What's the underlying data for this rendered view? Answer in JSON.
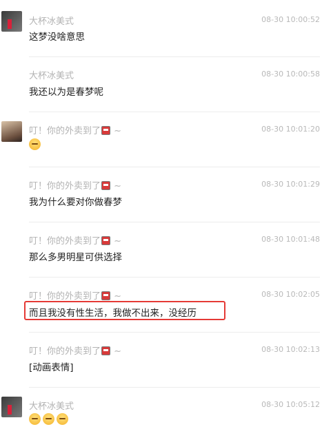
{
  "messages": [
    {
      "sender": "大杯冰美式",
      "time": "08-30 10:00:52",
      "text": "这梦没啥意思"
    },
    {
      "sender": "大杯冰美式",
      "time": "08-30 10:00:58",
      "text": "我还以为是春梦呢"
    },
    {
      "sender": "叮！你的外卖到了",
      "time": "08-30 10:01:20",
      "emoji": "😴"
    },
    {
      "sender": "叮！你的外卖到了",
      "time": "08-30 10:01:29",
      "text": "我为什么要对你做春梦"
    },
    {
      "sender": "叮！你的外卖到了",
      "time": "08-30 10:01:48",
      "text": "那么多男明星可供选择"
    },
    {
      "sender": "叮！你的外卖到了",
      "time": "08-30 10:02:05",
      "text": "而且我没有性生活，我做不出来，没经历"
    },
    {
      "sender": "叮！你的外卖到了",
      "time": "08-30 10:02:13",
      "text": "[动画表情]"
    },
    {
      "sender": "大杯冰美式",
      "time": "08-30 10:05:12",
      "emoji": "😌😌😌"
    }
  ],
  "name_suffix": "~",
  "highlight_color": "#e53935"
}
